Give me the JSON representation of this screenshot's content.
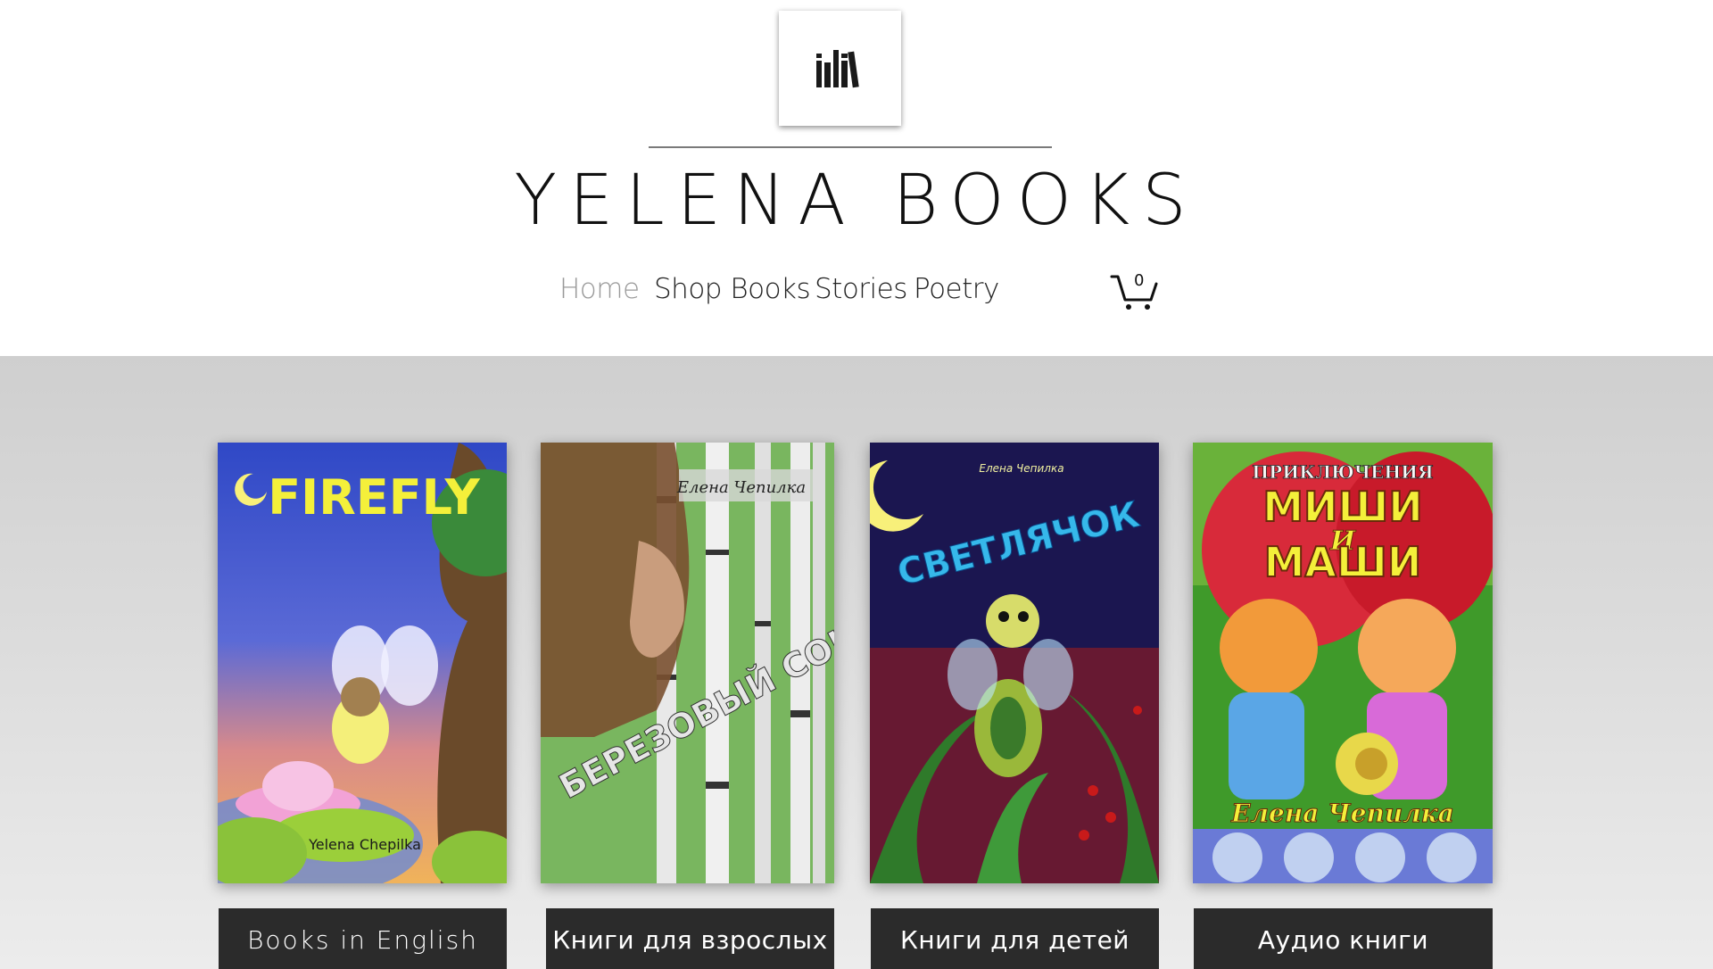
{
  "site": {
    "title": "YELENA BOOKS"
  },
  "nav": {
    "items": [
      {
        "label": "Home",
        "active": true
      },
      {
        "label": "Shop Books",
        "active": false
      },
      {
        "label": "Stories",
        "active": false
      },
      {
        "label": "Poetry",
        "active": false
      }
    ]
  },
  "cart": {
    "count": "0",
    "icon": "cart-icon"
  },
  "logo": {
    "icon": "books-icon"
  },
  "covers": [
    {
      "title": "FIREFLY",
      "author": "Yelena Chepilka"
    },
    {
      "title": "БЕРЕЗОВЫЙ СОК",
      "author": "Елена Чепилка"
    },
    {
      "title": "СВЕТЛЯЧОК",
      "author": "Елена Чепилка"
    },
    {
      "title_top": "ПРИКЛЮЧЕНИЯ",
      "title_line1": "МИШИ",
      "title_mid": "И",
      "title_line2": "МАШИ",
      "author": "Елена Чепилка"
    }
  ],
  "categories": [
    {
      "label": "Books in English"
    },
    {
      "label": "Книги для взрослых"
    },
    {
      "label": "Книги для детей"
    },
    {
      "label": "Аудио книги"
    }
  ],
  "colors": {
    "button_bg": "#2b2b2b",
    "nav_active": "#9a9a9a",
    "text": "#111111"
  }
}
